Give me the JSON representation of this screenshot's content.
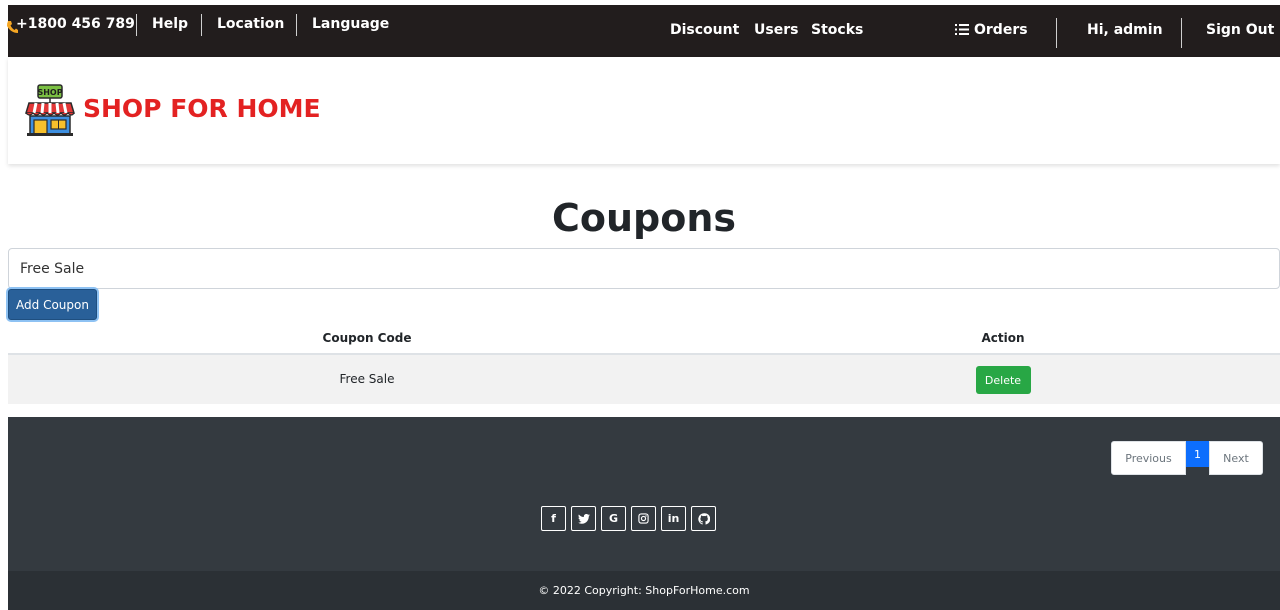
{
  "topbar": {
    "phone": "+1800 456 789",
    "help": "Help",
    "location": "Location",
    "language": "Language",
    "discount": "Discount",
    "users": "Users",
    "stocks": "Stocks",
    "orders": "Orders",
    "greeting": "Hi, admin",
    "sign_out": "Sign Out",
    "phone_icon": "phone-icon",
    "orders_icon": "list-icon",
    "background": "#221d1d"
  },
  "brand": {
    "name": "SHOP FOR HOME",
    "logo_text": "SHOP",
    "color": "#e32222"
  },
  "page": {
    "title": "Coupons"
  },
  "form": {
    "coupon_value": "Free Sale",
    "add_label": "Add Coupon",
    "add_color": "#296099"
  },
  "table": {
    "headers": [
      "Coupon Code",
      "Action"
    ],
    "rows": [
      {
        "code": "Free Sale",
        "action": "Delete"
      }
    ],
    "delete_color": "#28a745"
  },
  "pagination": {
    "previous": "Previous",
    "current": "1",
    "next": "Next"
  },
  "social": [
    {
      "label": "f",
      "icon": "facebook-icon"
    },
    {
      "label": "twitter",
      "icon": "twitter-icon"
    },
    {
      "label": "G",
      "icon": "google-icon"
    },
    {
      "label": "instagram",
      "icon": "instagram-icon"
    },
    {
      "label": "in",
      "icon": "linkedin-icon"
    },
    {
      "label": "github",
      "icon": "github-icon"
    }
  ],
  "footer": {
    "copyright": "© 2022 Copyright: ShopForHome.com",
    "background": "#343a40"
  }
}
